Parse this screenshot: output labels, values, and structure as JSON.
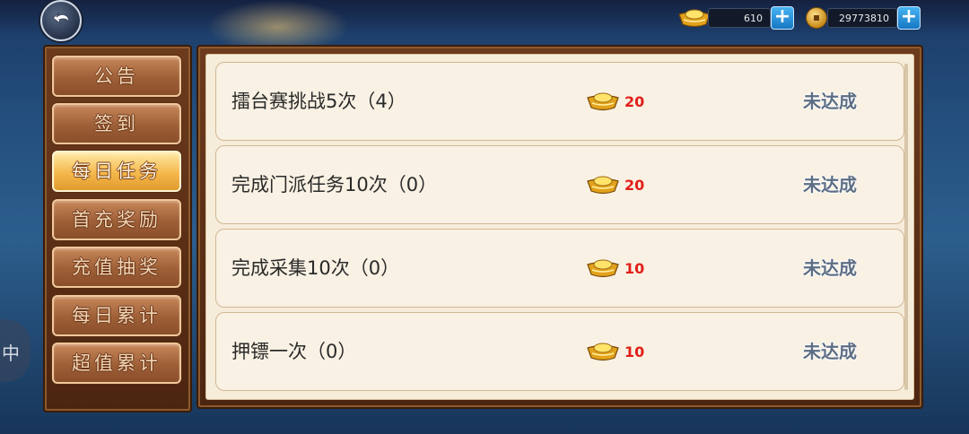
{
  "header": {
    "gold_ingot_amount": "610",
    "coin_amount": "29773810",
    "plus_symbol": "+"
  },
  "menu": {
    "items": [
      {
        "label": "公告",
        "active": false
      },
      {
        "label": "签到",
        "active": false
      },
      {
        "label": "每日任务",
        "active": true
      },
      {
        "label": "首充奖励",
        "active": false
      },
      {
        "label": "充值抽奖",
        "active": false
      },
      {
        "label": "每日累计",
        "active": false
      },
      {
        "label": "超值累计",
        "active": false
      }
    ]
  },
  "tasks": [
    {
      "title": "擂台赛挑战5次（4）",
      "reward": "20",
      "status": "未达成"
    },
    {
      "title": "完成门派任务10次（0）",
      "reward": "20",
      "status": "未达成"
    },
    {
      "title": "完成采集10次（0）",
      "reward": "10",
      "status": "未达成"
    },
    {
      "title": "押镖一次（0）",
      "reward": "10",
      "status": "未达成"
    }
  ],
  "floating": {
    "glyph": "中"
  },
  "icons": {
    "back": "back-arrow-icon",
    "ingot": "gold-ingot-icon",
    "coin": "copper-coin-icon",
    "plus": "plus-icon"
  },
  "colors": {
    "reward_amount": "#e0201a",
    "status_text": "#5d6e84",
    "active_tab": "#f4b84c",
    "plus_button": "#1677c4"
  }
}
